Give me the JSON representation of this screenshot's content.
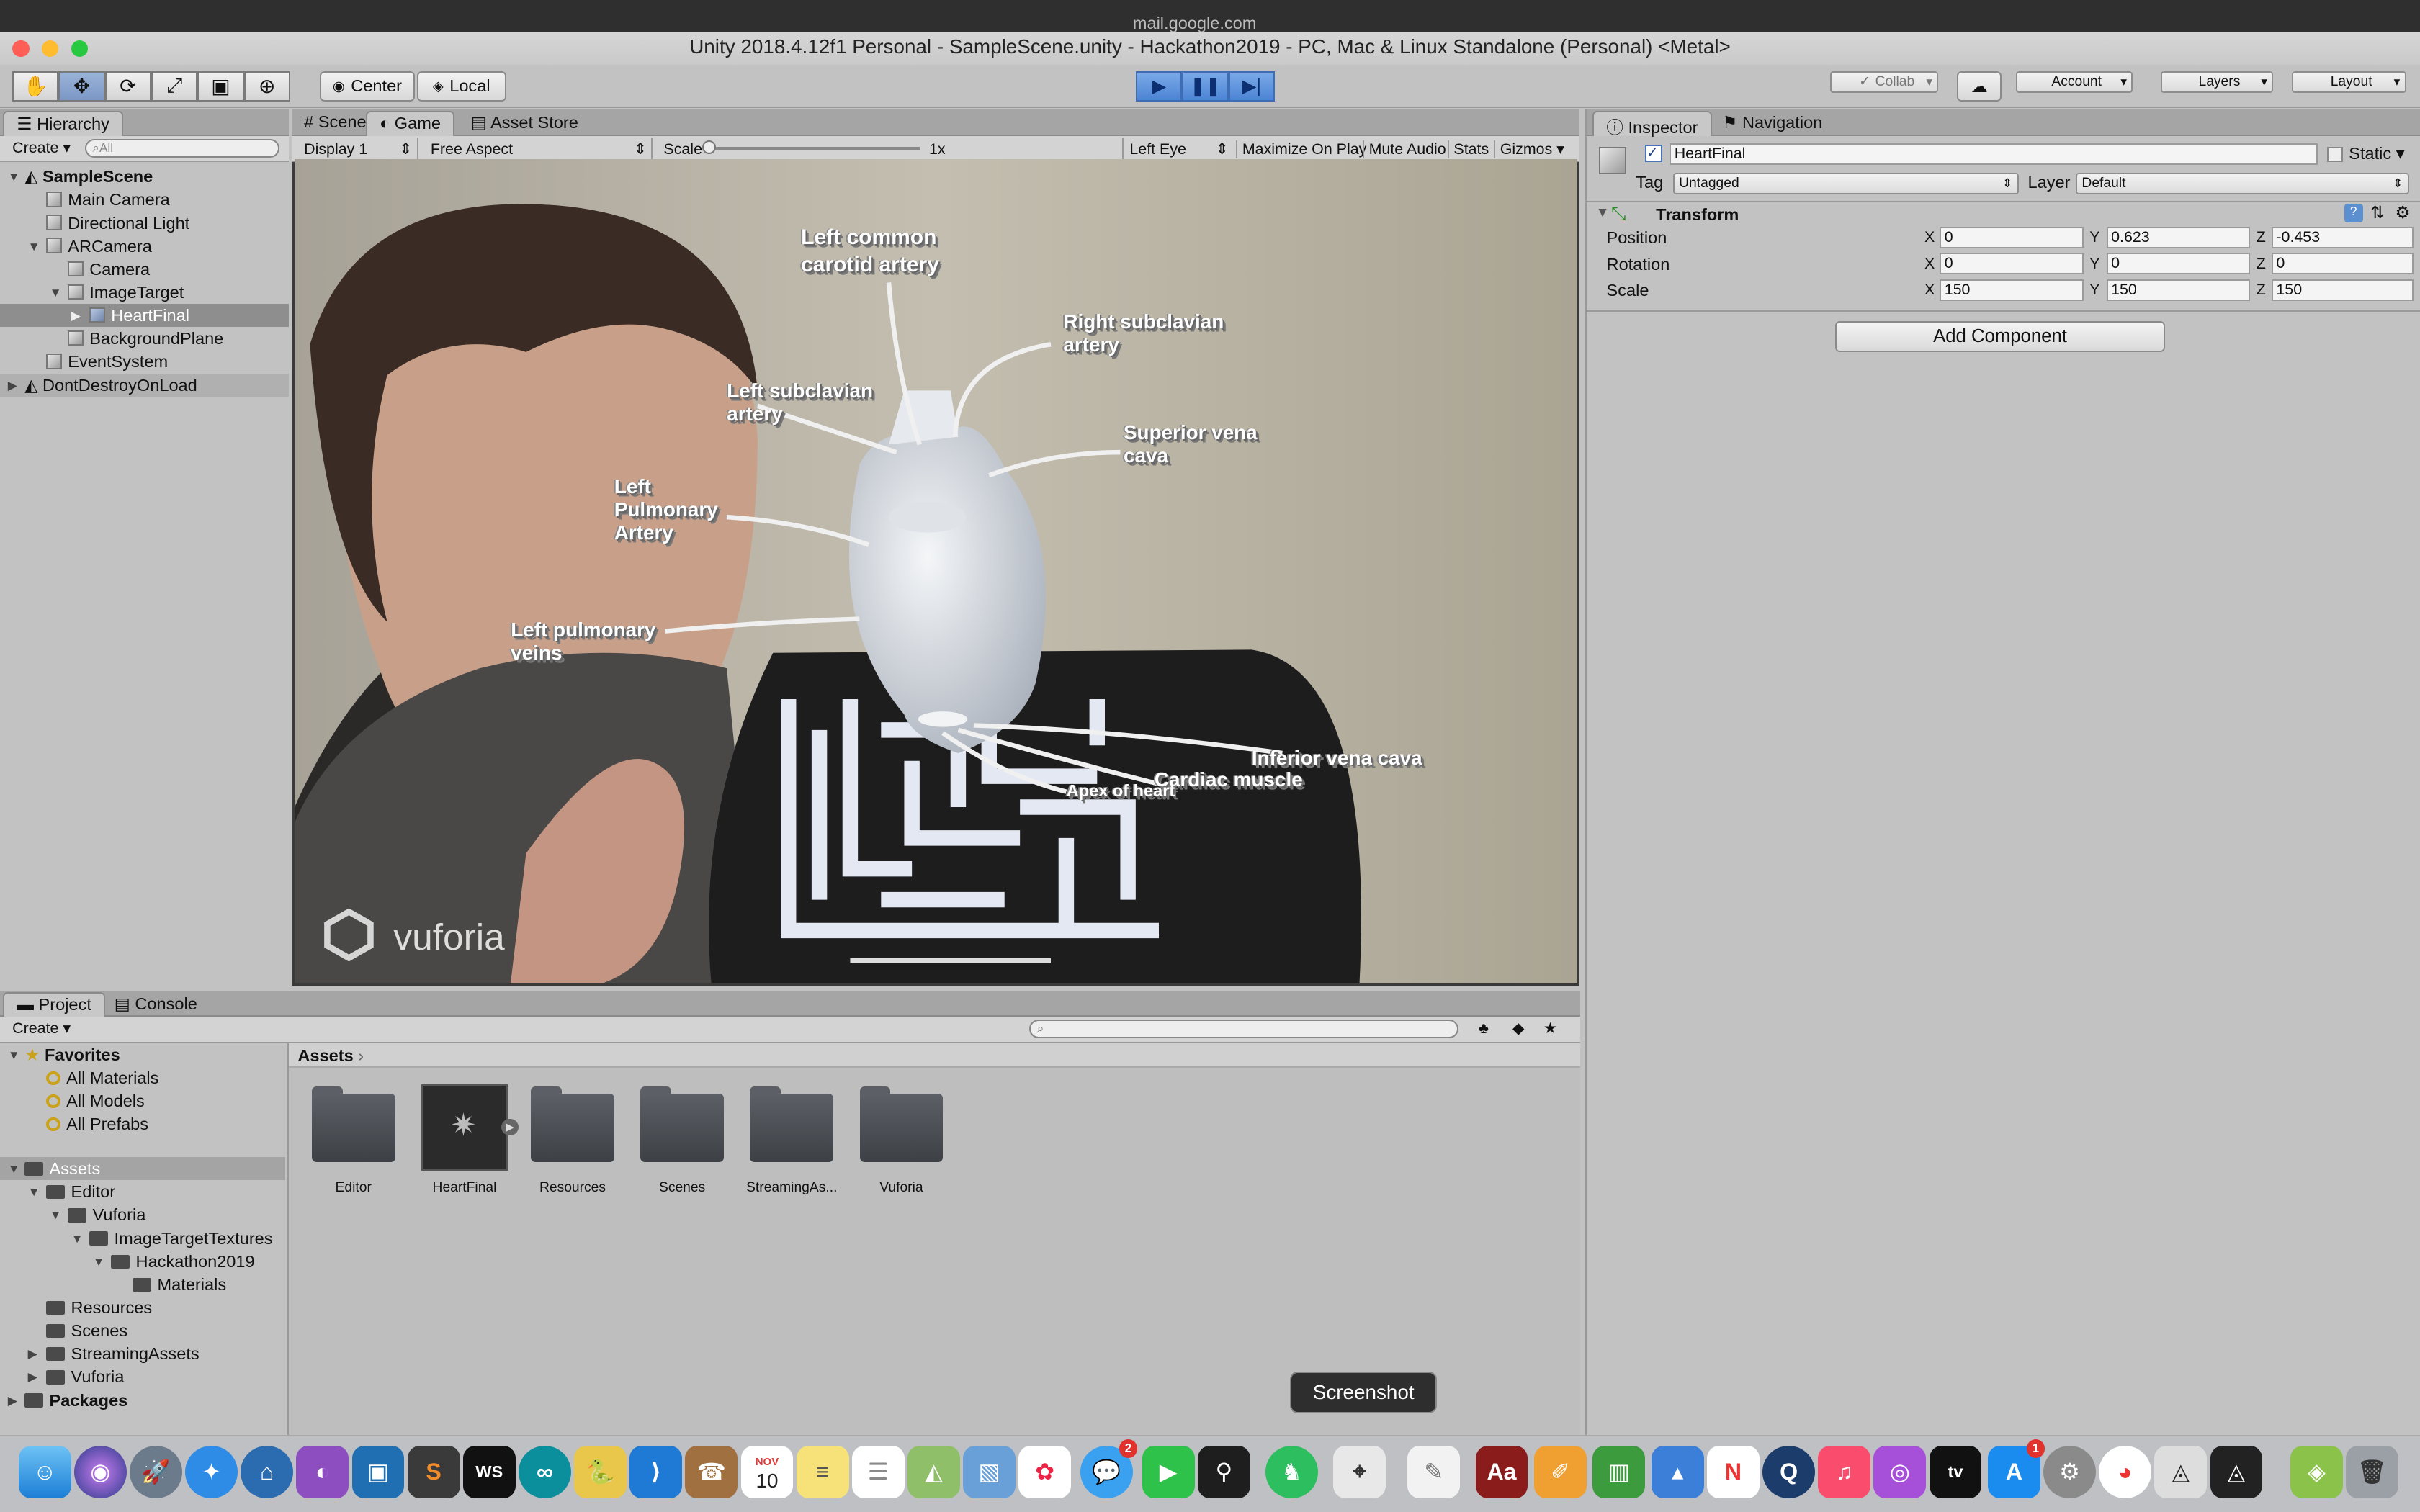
{
  "browser": {
    "url": "mail.google.com"
  },
  "window": {
    "title": "Unity 2018.4.12f1 Personal - SampleScene.unity - Hackathon2019 - PC, Mac & Linux Standalone (Personal) <Metal>"
  },
  "toolbar": {
    "pivot_label": "Center",
    "space_label": "Local",
    "collab_label": "Collab",
    "account_label": "Account",
    "layers_label": "Layers",
    "layout_label": "Layout"
  },
  "hierarchy": {
    "tab": "Hierarchy",
    "create": "Create",
    "search_placeholder": "All",
    "items": [
      "SampleScene",
      "Main Camera",
      "Directional Light",
      "ARCamera",
      "Camera",
      "ImageTarget",
      "HeartFinal",
      "BackgroundPlane",
      "EventSystem",
      "DontDestroyOnLoad"
    ]
  },
  "scene_tabs": {
    "scene": "Scene",
    "game": "Game",
    "asset_store": "Asset Store"
  },
  "game_bar": {
    "display": "Display 1",
    "aspect": "Free Aspect",
    "scale_label": "Scale",
    "scale_value": "1x",
    "eye": "Left Eye",
    "maximize": "Maximize On Play",
    "mute": "Mute Audio",
    "stats": "Stats",
    "gizmos": "Gizmos"
  },
  "game_view": {
    "watermark": "vuforia",
    "labels": {
      "l1": "Left common\ncarotid artery",
      "l2": "Right subclavian\nartery",
      "l3": "Left subclavian\nartery",
      "l4": "Superior vena\ncava",
      "l5": "Left\nPulmonary\nArtery",
      "l6": "Left pulmonary\nveins",
      "l7": "Inferior vena cava",
      "l8": "Cardiac muscle",
      "l9": "Apex of heart"
    }
  },
  "inspector": {
    "tab": "Inspector",
    "nav_tab": "Navigation",
    "object_name": "HeartFinal",
    "static_label": "Static",
    "tag_label": "Tag",
    "tag_value": "Untagged",
    "layer_label": "Layer",
    "layer_value": "Default",
    "component": "Transform",
    "rows": [
      {
        "label": "Position",
        "x": "0",
        "y": "0.623",
        "z": "-0.453"
      },
      {
        "label": "Rotation",
        "x": "0",
        "y": "0",
        "z": "0"
      },
      {
        "label": "Scale",
        "x": "150",
        "y": "150",
        "z": "150"
      }
    ],
    "add_component": "Add Component"
  },
  "project": {
    "tab": "Project",
    "console_tab": "Console",
    "create": "Create",
    "favorites": "Favorites",
    "fav_items": [
      "All Materials",
      "All Models",
      "All Prefabs"
    ],
    "tree": [
      "Assets",
      "Editor",
      "Vuforia",
      "ImageTargetTextures",
      "Hackathon2019",
      "Materials",
      "Resources",
      "Scenes",
      "StreamingAssets",
      "Vuforia",
      "Packages"
    ],
    "breadcrumb": "Assets",
    "assets": [
      "Editor",
      "HeartFinal",
      "Resources",
      "Scenes",
      "StreamingAs...",
      "Vuforia"
    ]
  },
  "dock": {
    "tooltip": "Screenshot",
    "calendar_month": "NOV",
    "calendar_day": "10",
    "messages_badge": "2",
    "appstore_badge": "1"
  }
}
